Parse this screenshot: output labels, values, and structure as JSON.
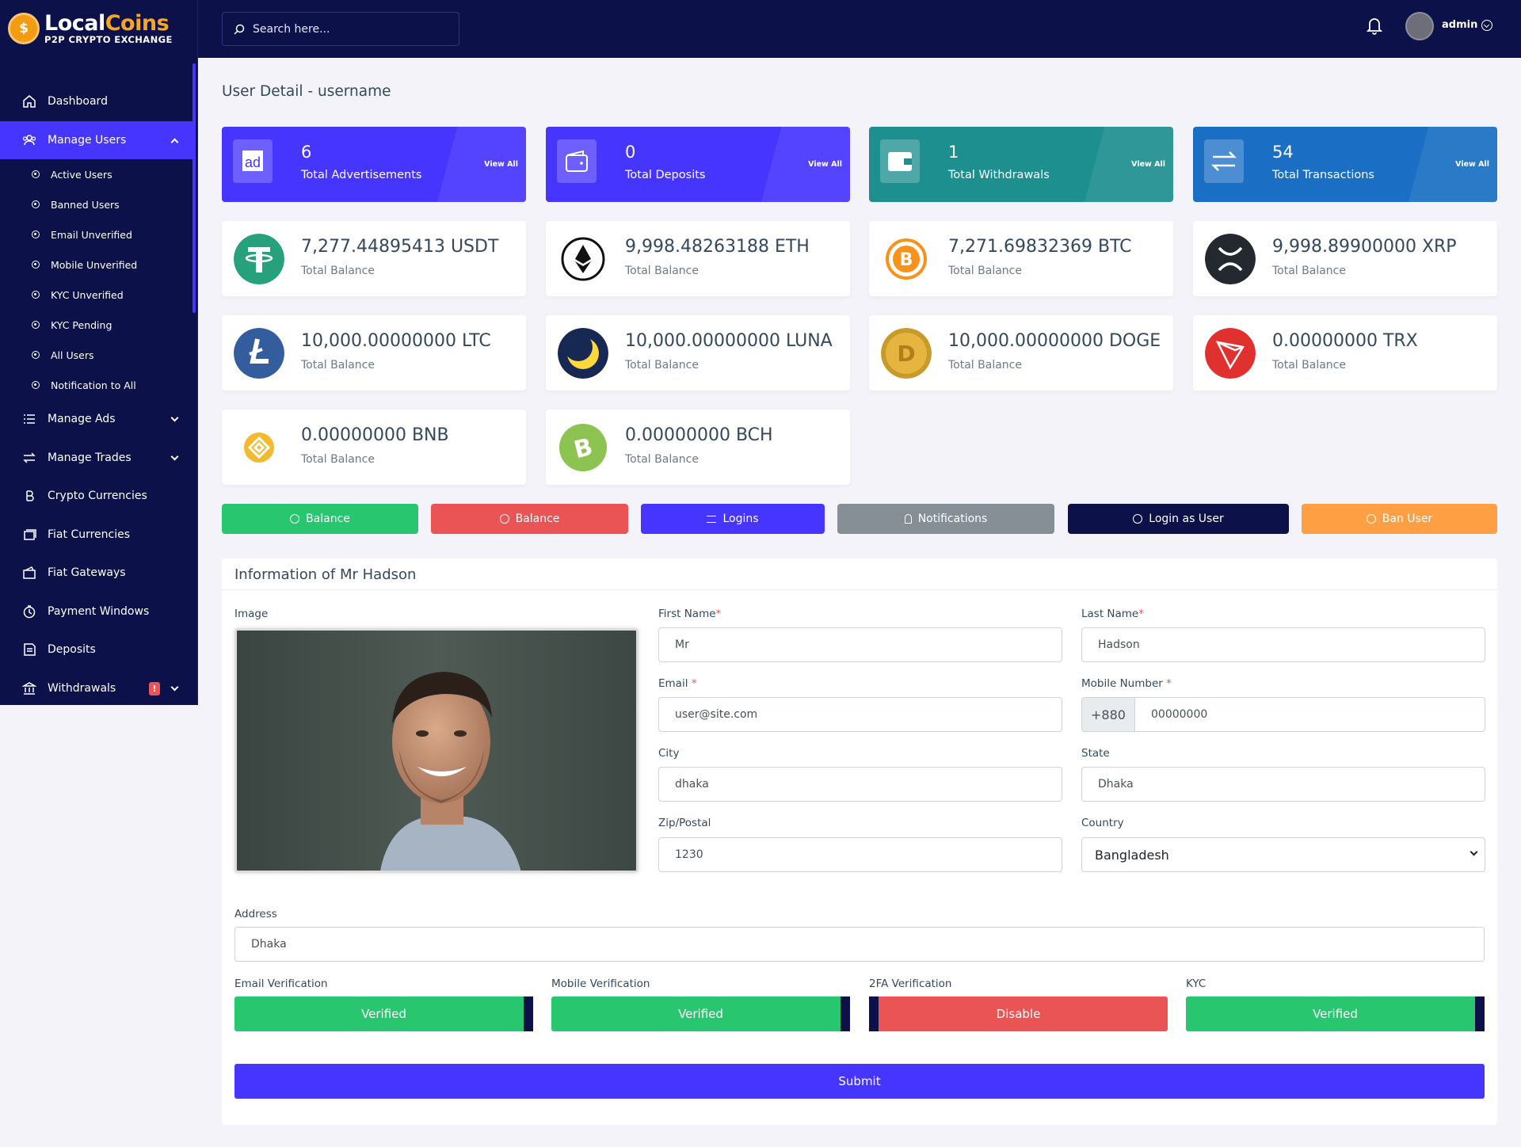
{
  "brand": {
    "name_part1": "Local",
    "name_part2": "Coins",
    "tagline": "P2P CRYPTO EXCHANGE"
  },
  "header": {
    "search_placeholder": "Search here...",
    "user": "admin"
  },
  "sidebar": {
    "items": [
      {
        "label": "Dashboard",
        "icon": "home-icon"
      },
      {
        "label": "Manage Users",
        "icon": "users-icon",
        "active": true,
        "expanded": true,
        "children": [
          "Active Users",
          "Banned Users",
          "Email Unverified",
          "Mobile Unverified",
          "KYC Unverified",
          "KYC Pending",
          "All Users",
          "Notification to All"
        ]
      },
      {
        "label": "Manage Ads",
        "icon": "list-icon"
      },
      {
        "label": "Manage Trades",
        "icon": "exchange-icon"
      },
      {
        "label": "Crypto Currencies",
        "icon": "bitcoin-icon"
      },
      {
        "label": "Fiat Currencies",
        "icon": "money-icon"
      },
      {
        "label": "Fiat Gateways",
        "icon": "gateway-icon"
      },
      {
        "label": "Payment Windows",
        "icon": "clock-icon"
      },
      {
        "label": "Deposits",
        "icon": "deposit-icon"
      },
      {
        "label": "Withdrawals",
        "icon": "bank-icon",
        "badge": "!"
      }
    ]
  },
  "page_title": "User Detail - username",
  "stats": [
    {
      "value": "6",
      "label": "Total Advertisements",
      "link": "View All",
      "color": "#4634ff"
    },
    {
      "value": "0",
      "label": "Total Deposits",
      "link": "View All",
      "color": "#4634ff"
    },
    {
      "value": "1",
      "label": "Total Withdrawals",
      "link": "View All",
      "color": "#1e8f8f"
    },
    {
      "value": "54",
      "label": "Total Transactions",
      "link": "View All",
      "color": "#1a6fc4"
    }
  ],
  "balances": [
    {
      "amount": "7,277.44895413 USDT",
      "label": "Total Balance",
      "icon": "usdt-icon"
    },
    {
      "amount": "9,998.48263188 ETH",
      "label": "Total Balance",
      "icon": "eth-icon"
    },
    {
      "amount": "7,271.69832369 BTC",
      "label": "Total Balance",
      "icon": "btc-icon"
    },
    {
      "amount": "9,998.89900000 XRP",
      "label": "Total Balance",
      "icon": "xrp-icon"
    },
    {
      "amount": "10,000.00000000 LTC",
      "label": "Total Balance",
      "icon": "ltc-icon"
    },
    {
      "amount": "10,000.00000000 LUNA",
      "label": "Total Balance",
      "icon": "luna-icon"
    },
    {
      "amount": "10,000.00000000 DOGE",
      "label": "Total Balance",
      "icon": "doge-icon"
    },
    {
      "amount": "0.00000000 TRX",
      "label": "Total Balance",
      "icon": "trx-icon"
    },
    {
      "amount": "0.00000000 BNB",
      "label": "Total Balance",
      "icon": "bnb-icon"
    },
    {
      "amount": "0.00000000 BCH",
      "label": "Total Balance",
      "icon": "bch-icon"
    }
  ],
  "actions": [
    {
      "label": "Balance",
      "color": "#28c76f",
      "icon": "plus-circle-icon"
    },
    {
      "label": "Balance",
      "color": "#ea5455",
      "icon": "minus-circle-icon"
    },
    {
      "label": "Logins",
      "color": "#4634ff",
      "icon": "list-icon"
    },
    {
      "label": "Notifications",
      "color": "#868e96",
      "icon": "bell-icon"
    },
    {
      "label": "Login as User",
      "color": "#0c114a",
      "icon": "login-icon"
    },
    {
      "label": "Ban User",
      "color": "#ff9f43",
      "icon": "ban-icon"
    }
  ],
  "form": {
    "title": "Information of Mr Hadson",
    "image_label": "Image",
    "first_name_label": "First Name",
    "first_name": "Mr",
    "last_name_label": "Last Name",
    "last_name": "Hadson",
    "email_label": "Email",
    "email": "user@site.com",
    "mobile_label": "Mobile Number",
    "mobile_prefix": "+880",
    "mobile": "00000000",
    "city_label": "City",
    "city": "dhaka",
    "state_label": "State",
    "state": "Dhaka",
    "zip_label": "Zip/Postal",
    "zip": "1230",
    "country_label": "Country",
    "country": "Bangladesh",
    "address_label": "Address",
    "address": "Dhaka",
    "verifications": [
      {
        "label": "Email Verification",
        "value": "Verified",
        "on": true
      },
      {
        "label": "Mobile Verification",
        "value": "Verified",
        "on": true
      },
      {
        "label": "2FA Verification",
        "value": "Disable",
        "on": false
      },
      {
        "label": "KYC",
        "value": "Verified",
        "on": true
      }
    ],
    "submit": "Submit"
  }
}
